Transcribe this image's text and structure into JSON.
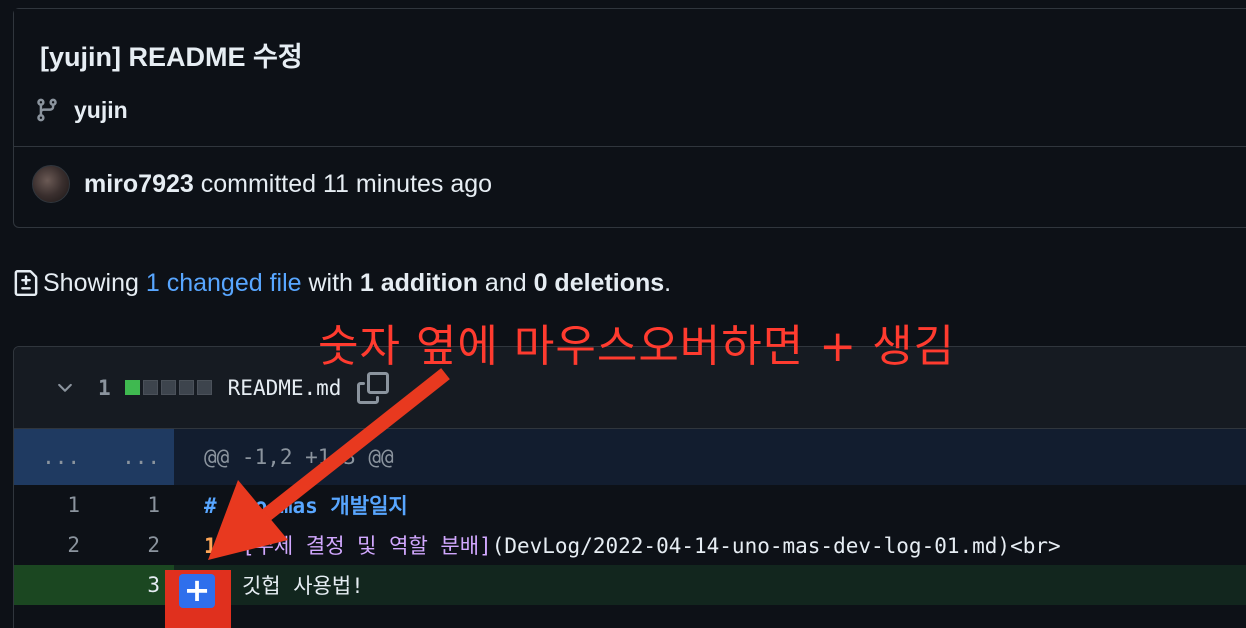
{
  "commit": {
    "title": "[yujin] README 수정",
    "branch": "yujin",
    "author": "miro7923",
    "action_time": " committed 11 minutes ago"
  },
  "summary": {
    "prefix": "Showing ",
    "changed_link": "1 changed file",
    "with": " with ",
    "additions": "1 addition",
    "and": " and ",
    "deletions": "0 deletions",
    "suffix": "."
  },
  "annotation": {
    "text": "숫자 옆에 마우스오버하면 + 생김",
    "color": "#ff3b2f"
  },
  "file": {
    "change_count": "1",
    "filename": "README.md",
    "diffstat": [
      "add",
      "neutral",
      "neutral",
      "neutral",
      "neutral"
    ]
  },
  "diff": {
    "hunk": {
      "old": "...",
      "new": "...",
      "header": "@@ -1,2 +1,3 @@"
    },
    "lines": [
      {
        "old": "1",
        "new": "1",
        "heading": "# uno-mas 개발일지"
      },
      {
        "old": "2",
        "new": "2",
        "num": "1.",
        "link_text": "[주제 결정 및 역할 분배]",
        "link_url": "(DevLog/2022-04-14-uno-mas-dev-log-01.md)<br>"
      },
      {
        "old": "",
        "new": "3",
        "num": "2.",
        "text": " 깃헙 사용법!"
      }
    ]
  },
  "plus_button": {
    "label": "+"
  },
  "colors": {
    "link": "#58a6ff",
    "add_bg": "#12261e",
    "add_gutter": "#1b4721",
    "hunk_bg": "#121d2f",
    "annotation": "#ff3b2f",
    "plus_btn": "#2f6fec"
  },
  "icons": {
    "branch": "git-branch-icon",
    "diff": "file-diff-icon",
    "chevron": "chevron-down-icon",
    "copy": "copy-icon"
  }
}
